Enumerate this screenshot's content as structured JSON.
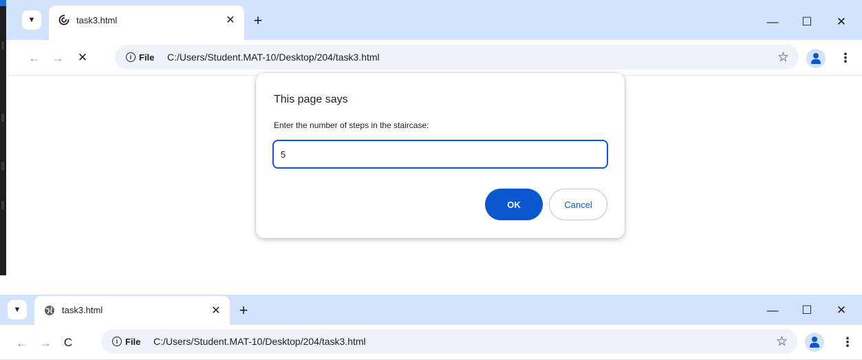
{
  "window1": {
    "tab": {
      "title": "task3.html",
      "close": "✕"
    },
    "new_tab": "+",
    "window_controls": {
      "minimize": "—",
      "maximize": "☐",
      "close": "✕"
    },
    "nav": {
      "back": "←",
      "forward": "→",
      "stop": "✕"
    },
    "omnibox": {
      "chip_label": "File",
      "url": "C:/Users/Student.MAT-10/Desktop/204/task3.html"
    },
    "dialog": {
      "title": "This page says",
      "message": "Enter the number of steps in the staircase:",
      "input_value": "5",
      "ok_label": "OK",
      "cancel_label": "Cancel"
    }
  },
  "window2": {
    "tab": {
      "title": "task3.html",
      "close": "✕"
    },
    "new_tab": "+",
    "window_controls": {
      "minimize": "—",
      "maximize": "☐",
      "close": "✕"
    },
    "nav": {
      "back": "←",
      "forward": "→",
      "reload": "C"
    },
    "omnibox": {
      "chip_label": "File",
      "url": "C:/Users/Student.MAT-10/Desktop/204/task3.html"
    }
  },
  "icons": {
    "tab_search": "chevron-down-icon",
    "favicon_loading": "loading-spinner-icon",
    "favicon": "globe-icon",
    "info": "info-icon",
    "bookmark": "star-icon",
    "profile": "profile-icon",
    "menu": "kebab-menu-icon"
  },
  "colors": {
    "tabstrip": "#d3e3fd",
    "accent": "#0b57d0",
    "omnibox": "#eef2f9"
  }
}
